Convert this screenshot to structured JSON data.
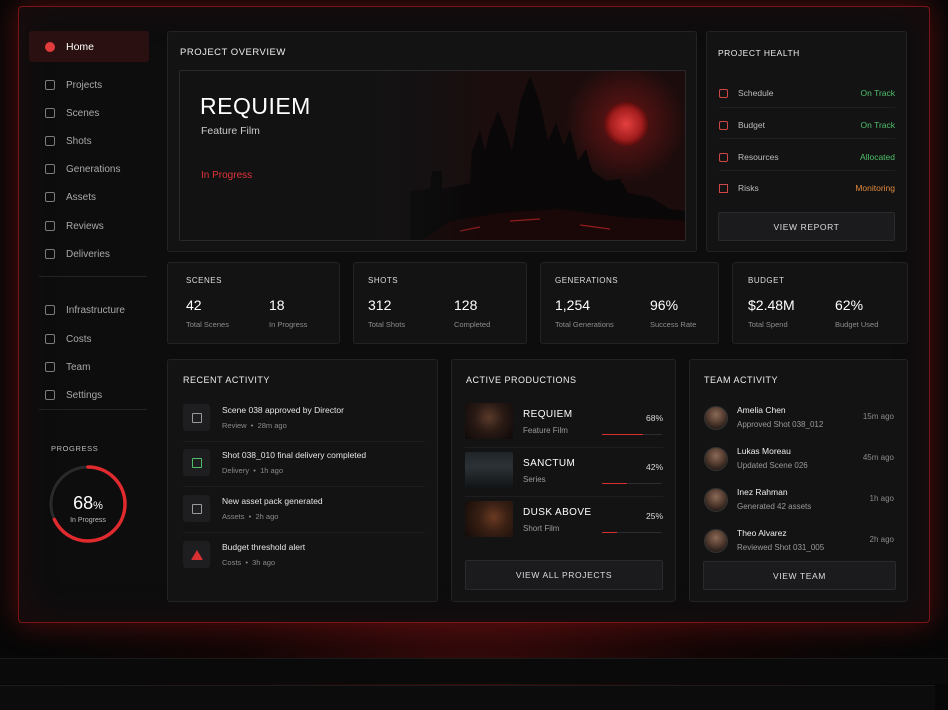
{
  "sidebar": {
    "items": [
      {
        "label": "Home",
        "icon": "home-icon",
        "active": true
      },
      {
        "label": "Projects",
        "icon": "folder-icon"
      },
      {
        "label": "Scenes",
        "icon": "scenes-icon"
      },
      {
        "label": "Shots",
        "icon": "camera-icon"
      },
      {
        "label": "Generations",
        "icon": "generations-icon"
      },
      {
        "label": "Assets",
        "icon": "assets-icon"
      },
      {
        "label": "Reviews",
        "icon": "reviews-icon"
      },
      {
        "label": "Deliveries",
        "icon": "deliveries-icon"
      },
      {
        "label": "Infrastructure",
        "icon": "server-icon"
      },
      {
        "label": "Costs",
        "icon": "costs-icon"
      },
      {
        "label": "Team",
        "icon": "team-icon"
      },
      {
        "label": "Settings",
        "icon": "gear-icon"
      }
    ],
    "progress": {
      "label": "PROGRESS",
      "value": 68,
      "value_text": "68",
      "unit": "%",
      "status": "In Progress"
    }
  },
  "overview": {
    "title": "PROJECT OVERVIEW",
    "project_name": "REQUIEM",
    "project_type": "Feature Film",
    "status": "In Progress"
  },
  "health": {
    "title": "PROJECT HEALTH",
    "rows": [
      {
        "label": "Schedule",
        "value": "On Track",
        "color": "#4fbf6a",
        "icon": "clock-icon"
      },
      {
        "label": "Budget",
        "value": "On Track",
        "color": "#4fbf6a",
        "icon": "budget-icon"
      },
      {
        "label": "Resources",
        "value": "Allocated",
        "color": "#4fbf6a",
        "icon": "users-icon"
      },
      {
        "label": "Risks",
        "value": "Monitoring",
        "color": "#e08a3c",
        "icon": "warning-icon"
      }
    ],
    "button": "VIEW REPORT"
  },
  "stats": [
    {
      "title": "SCENES",
      "a_num": "42",
      "a_lbl": "Total Scenes",
      "b_num": "18",
      "b_lbl": "In Progress"
    },
    {
      "title": "SHOTS",
      "a_num": "312",
      "a_lbl": "Total Shots",
      "b_num": "128",
      "b_lbl": "Completed"
    },
    {
      "title": "GENERATIONS",
      "a_num": "1,254",
      "a_lbl": "Total Generations",
      "b_num": "96%",
      "b_lbl": "Success Rate"
    },
    {
      "title": "BUDGET",
      "a_num": "$2.48M",
      "a_lbl": "Total Spend",
      "b_num": "62%",
      "b_lbl": "Budget Used"
    }
  ],
  "activity": {
    "title": "RECENT ACTIVITY",
    "items": [
      {
        "title": "Scene 038 approved by Director",
        "category": "Review",
        "time": "28m ago",
        "icon": "review-icon"
      },
      {
        "title": "Shot 038_010 final delivery completed",
        "category": "Delivery",
        "time": "1h ago",
        "icon": "delivery-icon"
      },
      {
        "title": "New asset pack generated",
        "category": "Assets",
        "time": "2h ago",
        "icon": "asset-icon"
      },
      {
        "title": "Budget threshold alert",
        "category": "Costs",
        "time": "3h ago",
        "icon": "alert-icon"
      }
    ]
  },
  "productions": {
    "title": "ACTIVE PRODUCTIONS",
    "items": [
      {
        "name": "REQUIEM",
        "type": "Feature Film",
        "pct_text": "68%",
        "progress": 0.68
      },
      {
        "name": "SANCTUM",
        "type": "Series",
        "pct_text": "42%",
        "progress": 0.42
      },
      {
        "name": "DUSK ABOVE",
        "type": "Short Film",
        "pct_text": "25%",
        "progress": 0.25
      }
    ],
    "button": "VIEW ALL PROJECTS"
  },
  "team": {
    "title": "TEAM ACTIVITY",
    "items": [
      {
        "name": "Amelia Chen",
        "action": "Approved Shot 038_012",
        "time": "15m ago"
      },
      {
        "name": "Lukas Moreau",
        "action": "Updated Scene 026",
        "time": "45m ago"
      },
      {
        "name": "Inez Rahman",
        "action": "Generated 42 assets",
        "time": "1h ago"
      },
      {
        "name": "Theo Alvarez",
        "action": "Reviewed Shot 031_005",
        "time": "2h ago"
      }
    ],
    "button": "VIEW TEAM"
  },
  "colors": {
    "accent": "#e23b3b",
    "ok": "#4fbf6a",
    "warn": "#e08a3c"
  }
}
